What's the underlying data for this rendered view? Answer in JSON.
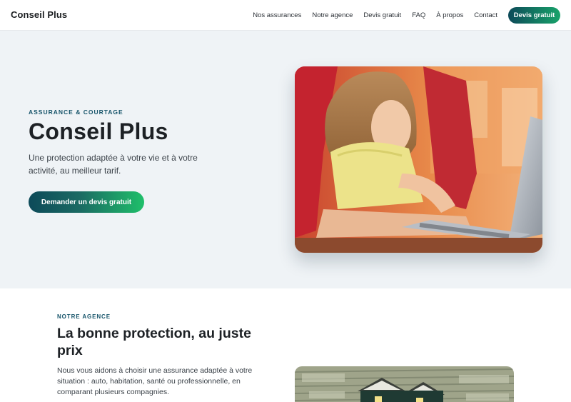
{
  "header": {
    "brand": "Conseil Plus",
    "nav": [
      "Nos assurances",
      "Notre agence",
      "Devis gratuit",
      "FAQ",
      "À propos",
      "Contact"
    ],
    "cta": "Devis gratuit"
  },
  "hero": {
    "eyebrow": "ASSURANCE & COURTAGE",
    "title": "Conseil Plus",
    "subtitle": "Une protection adaptée à votre vie et à votre activité, au meilleur tarif.",
    "button": "Demander un devis gratuit"
  },
  "agency": {
    "eyebrow": "NOTRE AGENCE",
    "title": "La bonne protection, au juste prix",
    "text": "Nous vous aidons à choisir une assurance adaptée à votre situation : auto, habitation, santé ou professionnelle, en comparant plusieurs compagnies."
  },
  "colors": {
    "accent_dark": "#0d4a59",
    "accent_green": "#1fbf6a",
    "hero_bg": "#eff3f6"
  }
}
